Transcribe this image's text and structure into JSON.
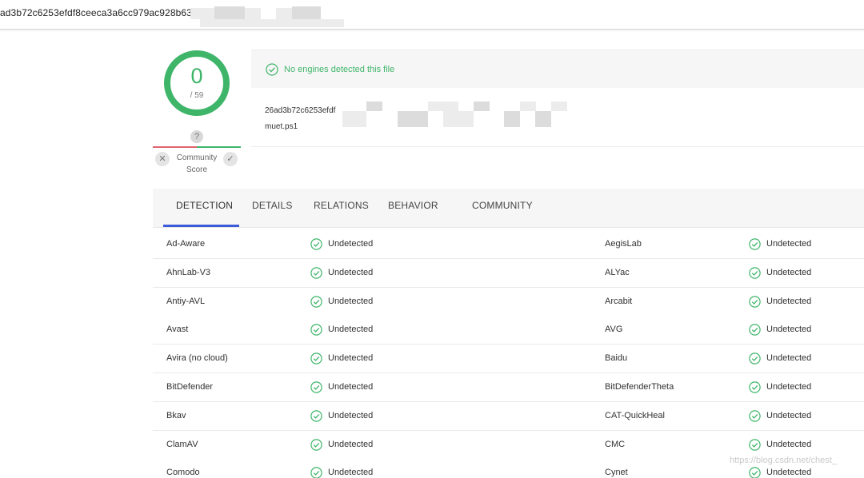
{
  "topbar": {
    "hash_text": "ad3b72c6253efdf8ceeca3a6cc979ac928b630"
  },
  "score": {
    "detected": "0",
    "total": "/ 59",
    "help_glyph": "?",
    "community_label_1": "Community",
    "community_label_2": "Score",
    "down_glyph": "✕",
    "up_glyph": "✓"
  },
  "summary": {
    "banner": "No engines detected this file",
    "file_hash": "26ad3b72c6253efdf",
    "file_name": "muet.ps1"
  },
  "tabs": [
    "DETECTION",
    "DETAILS",
    "RELATIONS",
    "BEHAVIOR",
    "COMMUNITY"
  ],
  "detections": [
    {
      "left_engine": "Ad-Aware",
      "left_result": "Undetected",
      "right_engine": "AegisLab",
      "right_result": "Undetected"
    },
    {
      "left_engine": "AhnLab-V3",
      "left_result": "Undetected",
      "right_engine": "ALYac",
      "right_result": "Undetected"
    },
    {
      "left_engine": "Antiy-AVL",
      "left_result": "Undetected",
      "right_engine": "Arcabit",
      "right_result": "Undetected"
    },
    {
      "left_engine": "Avast",
      "left_result": "Undetected",
      "right_engine": "AVG",
      "right_result": "Undetected"
    },
    {
      "left_engine": "Avira (no cloud)",
      "left_result": "Undetected",
      "right_engine": "Baidu",
      "right_result": "Undetected"
    },
    {
      "left_engine": "BitDefender",
      "left_result": "Undetected",
      "right_engine": "BitDefenderTheta",
      "right_result": "Undetected"
    },
    {
      "left_engine": "Bkav",
      "left_result": "Undetected",
      "right_engine": "CAT-QuickHeal",
      "right_result": "Undetected"
    },
    {
      "left_engine": "ClamAV",
      "left_result": "Undetected",
      "right_engine": "CMC",
      "right_result": "Undetected"
    },
    {
      "left_engine": "Comodo",
      "left_result": "Undetected",
      "right_engine": "Cynet",
      "right_result": "Undetected"
    }
  ],
  "watermark": "https://blog.csdn.net/chest_",
  "colors": {
    "accent_green": "#3fb56a",
    "accent_red": "#e0646f",
    "tab_active": "#3b5bdb"
  }
}
